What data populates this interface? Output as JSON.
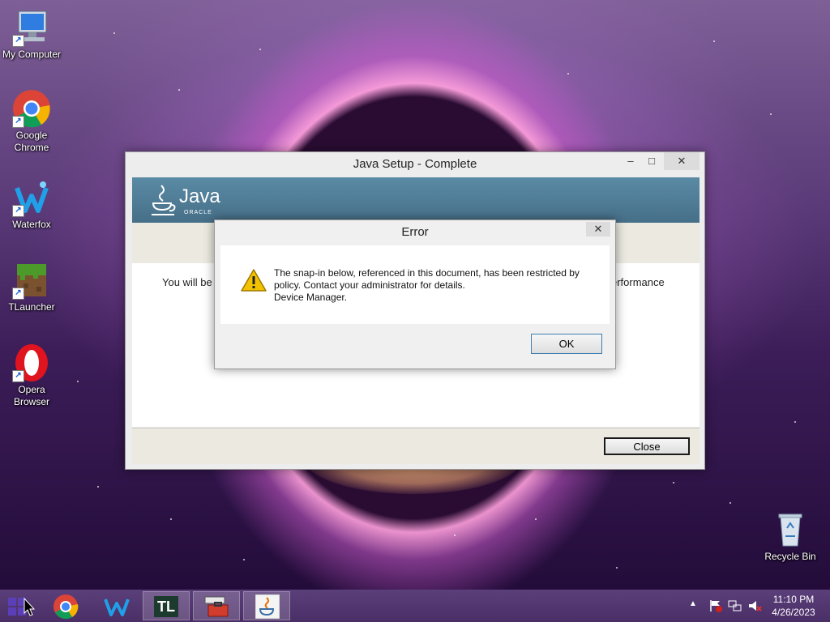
{
  "desktop": {
    "icons": [
      {
        "label": "My Computer"
      },
      {
        "label": "Google Chrome"
      },
      {
        "label": "Waterfox"
      },
      {
        "label": "TLauncher"
      },
      {
        "label": "Opera Browser"
      },
      {
        "label": "Recycle Bin"
      }
    ]
  },
  "java_window": {
    "title": "Java Setup - Complete",
    "minimize_glyph": "–",
    "maximize_glyph": "□",
    "close_glyph": "✕",
    "logo_text": "Java",
    "logo_sub": "ORACLE",
    "body_text_left": "You will be",
    "body_text_right": "erformance",
    "close_button": "Close"
  },
  "error_dialog": {
    "title": "Error",
    "close_glyph": "✕",
    "message_line1": "The snap-in below, referenced in this document, has been restricted by",
    "message_line2": "policy. Contact your administrator for details.",
    "message_line3": "Device Manager.",
    "ok_button": "OK"
  },
  "taskbar": {
    "apps": [
      "start",
      "Google Chrome",
      "Waterfox",
      "TLauncher",
      "Toolbox",
      "Java Setup"
    ],
    "tl_text": "TL",
    "time": "11:10 PM",
    "date": "4/26/2023",
    "tray_chevron": "▲"
  },
  "colors": {
    "java_banner": "#4f7d97",
    "taskbar": "#4a2e66",
    "warning": "#f2c200"
  }
}
